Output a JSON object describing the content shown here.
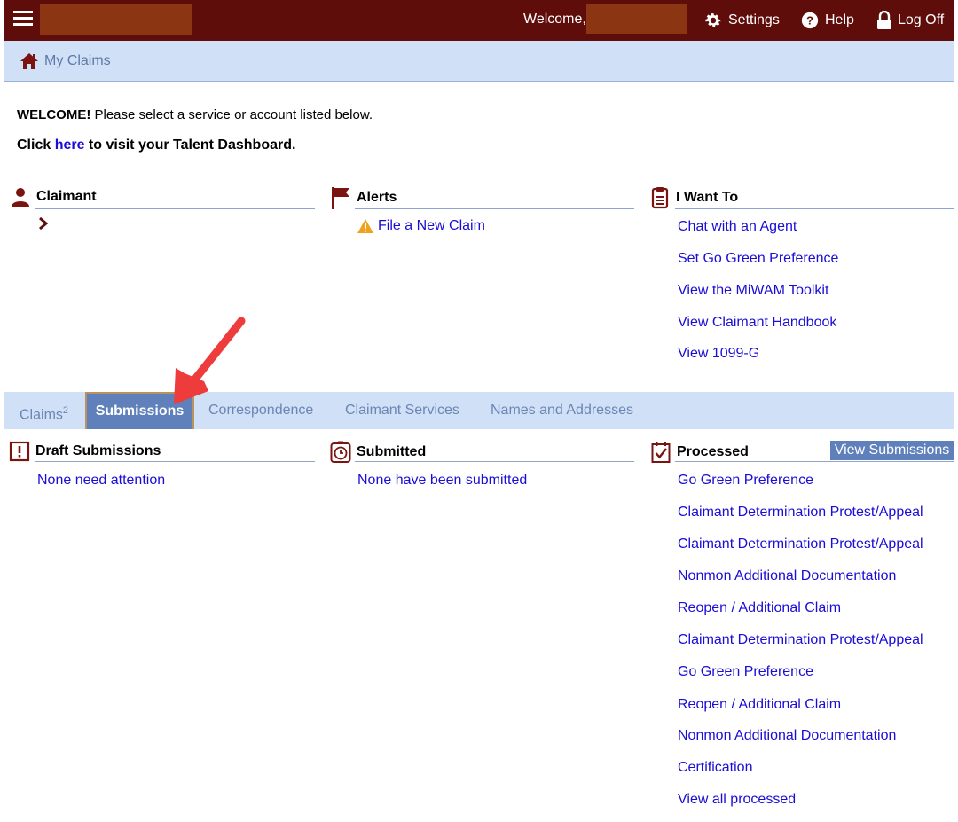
{
  "header": {
    "welcome": "Welcome,",
    "settings": "Settings",
    "help": "Help",
    "logoff": "Log Off"
  },
  "breadcrumb": {
    "label": "My Claims"
  },
  "intro": {
    "welcome_bold": "WELCOME!",
    "welcome_rest": " Please select a service or account listed below.",
    "click": "Click ",
    "here": "here",
    "dashboard": " to visit your Talent Dashboard."
  },
  "claimant": {
    "title": "Claimant"
  },
  "alerts": {
    "title": "Alerts",
    "items": [
      "File a New Claim"
    ]
  },
  "i_want_to": {
    "title": "I Want To",
    "items": [
      "Chat with an Agent",
      "Set Go Green Preference",
      "View the MiWAM Toolkit",
      "View Claimant Handbook",
      "View 1099-G"
    ]
  },
  "tabs": {
    "claims": "Claims",
    "claims_count": "2",
    "submissions": "Submissions",
    "correspondence": "Correspondence",
    "claimant_services": "Claimant Services",
    "names_addresses": "Names and Addresses"
  },
  "draft": {
    "title": "Draft Submissions",
    "items": [
      "None need attention"
    ]
  },
  "submitted": {
    "title": "Submitted",
    "items": [
      "None have been submitted"
    ]
  },
  "processed": {
    "title": "Processed",
    "button": "View Submissions",
    "items": [
      "Go Green Preference",
      "Claimant Determination Protest/Appeal",
      "Claimant Determination Protest/Appeal",
      "Nonmon Additional Documentation",
      "Reopen / Additional Claim",
      "Claimant Determination Protest/Appeal",
      "Go Green Preference",
      "Reopen / Additional Claim",
      "Nonmon Additional Documentation",
      "Certification",
      "View all processed"
    ]
  },
  "colors": {
    "topbar": "#5e0d0b",
    "link": "#1a0dd6",
    "tab_active": "#5f80ba",
    "strip": "#cfe0f7",
    "arrow": "#ee3b3b"
  }
}
